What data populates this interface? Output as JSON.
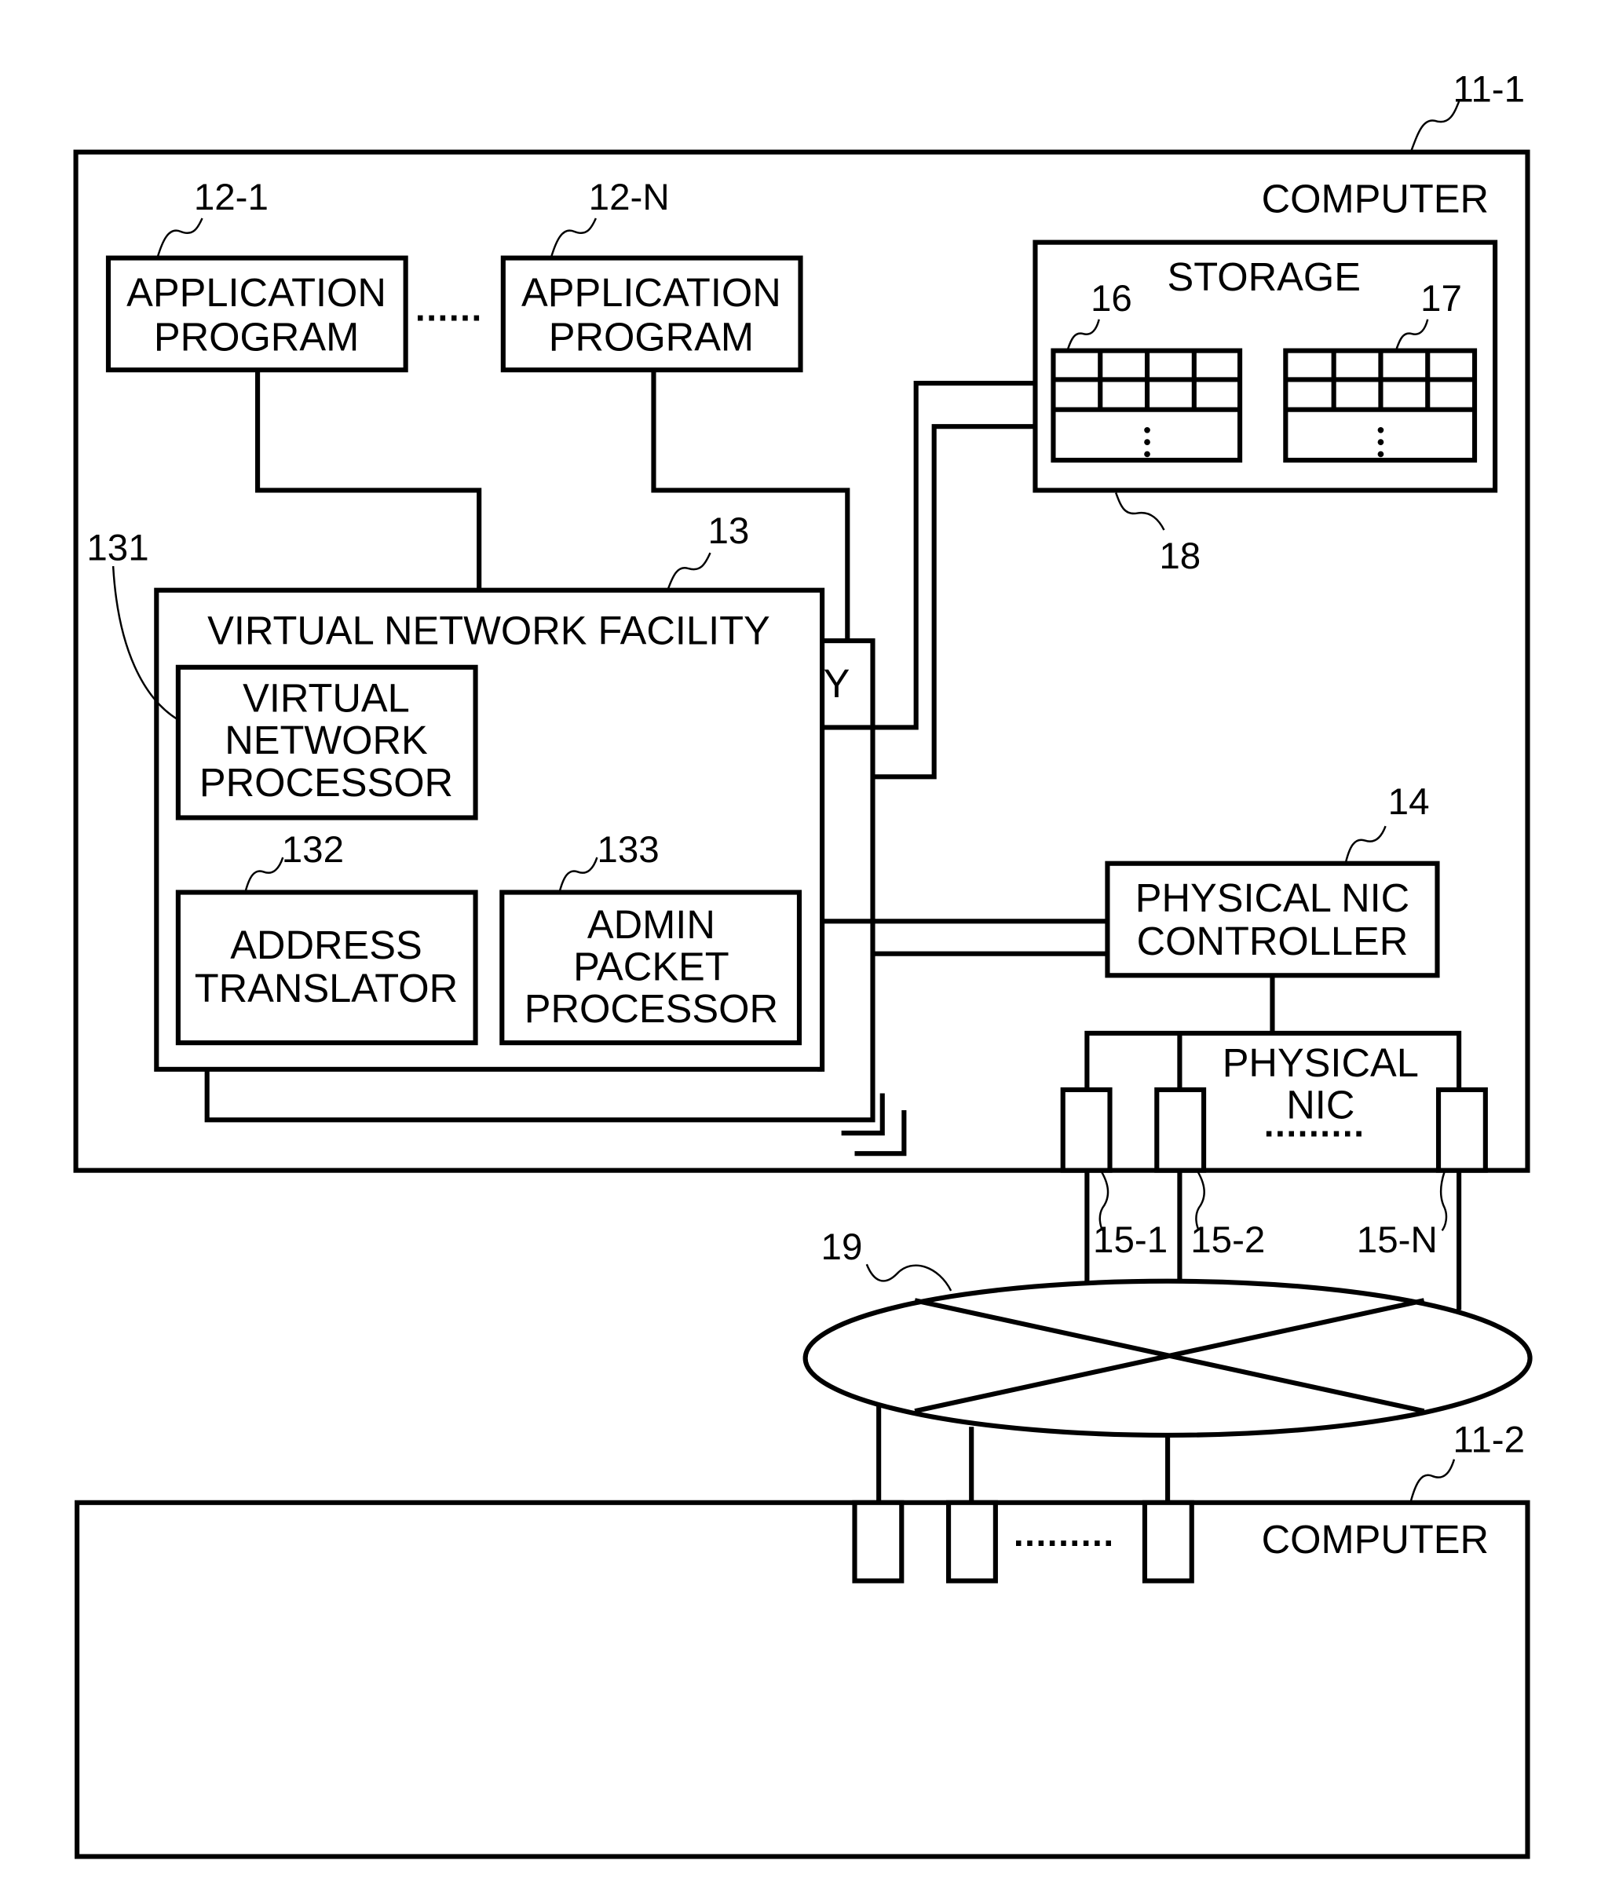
{
  "figure": {
    "computer_top": {
      "ref": "11-1",
      "label": "COMPUTER",
      "app_programs": [
        {
          "ref": "12-1",
          "line1": "APPLICATION",
          "line2": "PROGRAM"
        },
        {
          "ref": "12-N",
          "line1": "APPLICATION",
          "line2": "PROGRAM"
        }
      ],
      "app_ellipsis": "......",
      "storage": {
        "ref": "18",
        "label": "STORAGE",
        "tables": [
          {
            "ref": "16",
            "ellipsis": "⋮"
          },
          {
            "ref": "17",
            "ellipsis": "⋮"
          }
        ]
      },
      "virtual_network_facility": {
        "ref": "13",
        "label": "VIRTUAL NETWORK FACILITY",
        "stacked_tail": "Y",
        "virtual_network_processor": {
          "ref": "131",
          "line1": "VIRTUAL",
          "line2": "NETWORK",
          "line3": "PROCESSOR"
        },
        "address_translator": {
          "ref": "132",
          "line1": "ADDRESS",
          "line2": "TRANSLATOR"
        },
        "admin_packet_processor": {
          "ref": "133",
          "line1": "ADMIN",
          "line2": "PACKET",
          "line3": "PROCESSOR"
        }
      },
      "physical_nic_controller": {
        "ref": "14",
        "line1": "PHYSICAL NIC",
        "line2": "CONTROLLER"
      },
      "physical_nic": {
        "line1": "PHYSICAL",
        "line2": "NIC",
        "ellipsis": ".........",
        "ports": [
          "15-1",
          "15-2",
          "15-N"
        ]
      }
    },
    "network": {
      "ref": "19"
    },
    "computer_bottom": {
      "ref": "11-2",
      "label": "COMPUTER",
      "port_ellipsis": "........."
    }
  }
}
